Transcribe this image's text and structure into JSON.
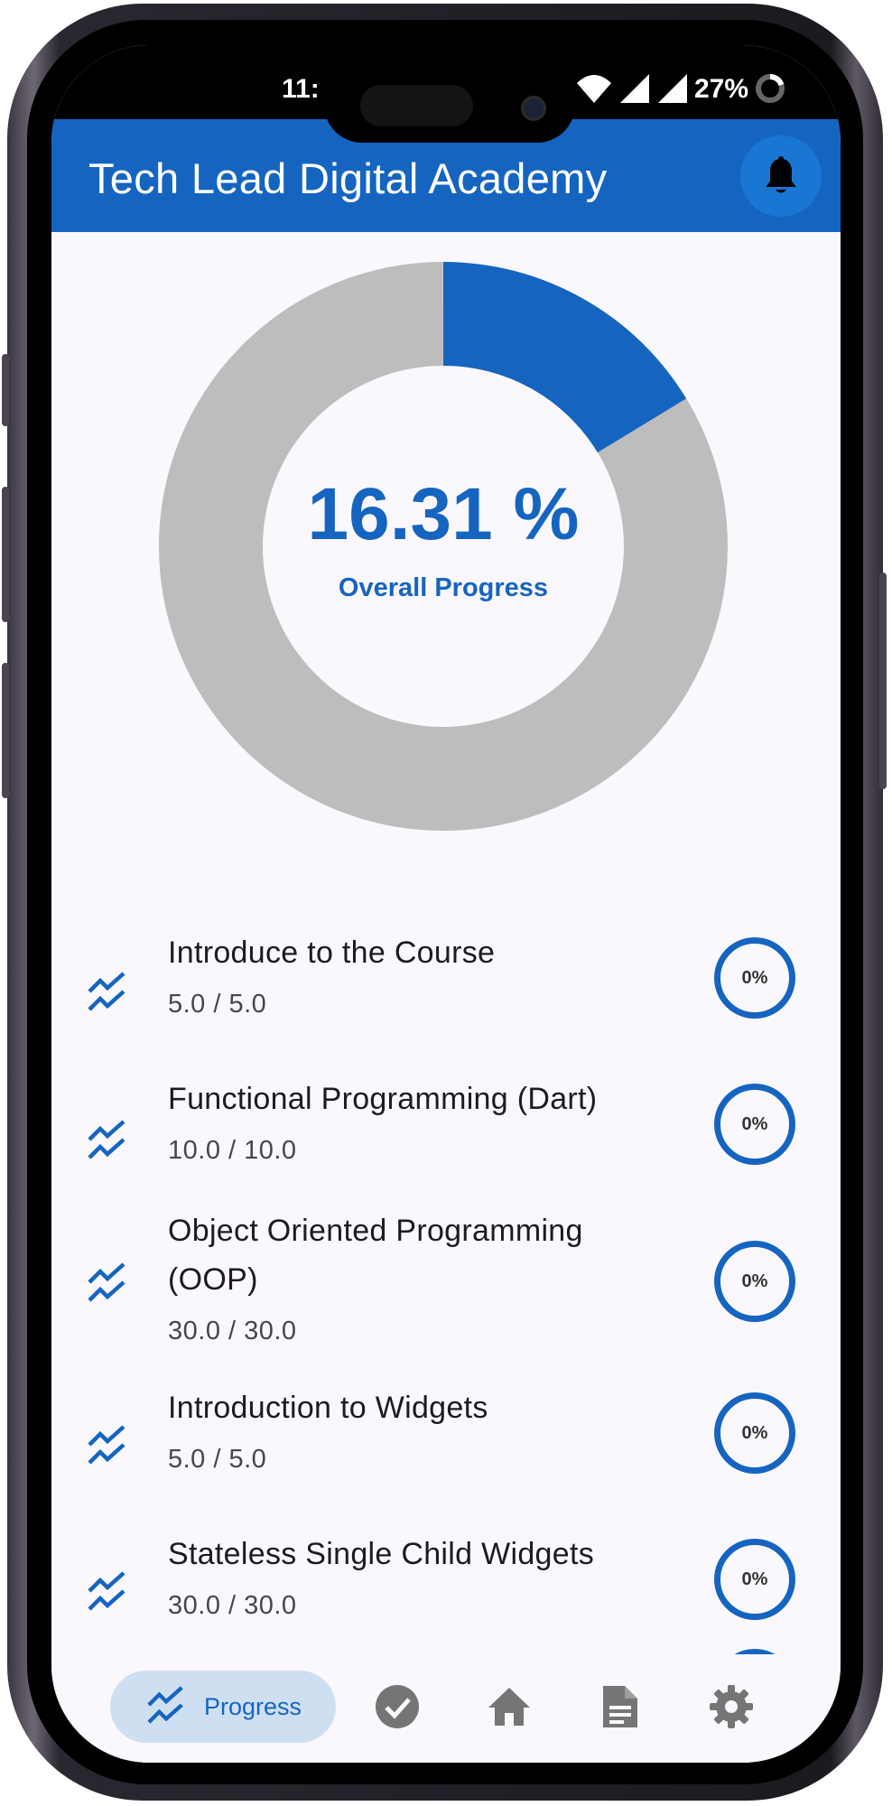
{
  "status_bar": {
    "time": "11:",
    "battery": "27%"
  },
  "app_bar": {
    "title": "Tech Lead Digital Academy",
    "notification_icon": "bell-icon"
  },
  "progress": {
    "value_text": "16.31 %",
    "label": "Overall Progress",
    "fraction": 0.1631,
    "colors": {
      "filled": "#1565c0",
      "remaining": "#bdbdbd"
    }
  },
  "courses": [
    {
      "title": "Introduce to the Course",
      "score": "5.0 / 5.0",
      "percent": "0%"
    },
    {
      "title": "Functional Programming (Dart)",
      "score": "10.0 / 10.0",
      "percent": "0%"
    },
    {
      "title": "Object Oriented Programming (OOP)",
      "score": "30.0 / 30.0",
      "percent": "0%"
    },
    {
      "title": "Introduction to Widgets",
      "score": "5.0 / 5.0",
      "percent": "0%"
    },
    {
      "title": "Stateless Single Child Widgets",
      "score": "30.0 / 30.0",
      "percent": "0%"
    }
  ],
  "bottom_nav": {
    "items": [
      {
        "label": "Progress",
        "icon": "trending-up-icon",
        "active": true
      },
      {
        "label": "",
        "icon": "check-circle-icon",
        "active": false
      },
      {
        "label": "",
        "icon": "home-icon",
        "active": false
      },
      {
        "label": "",
        "icon": "document-icon",
        "active": false
      },
      {
        "label": "",
        "icon": "gear-icon",
        "active": false
      }
    ]
  },
  "theme": {
    "primary": "#1565c0",
    "background": "#fbf8fd"
  }
}
